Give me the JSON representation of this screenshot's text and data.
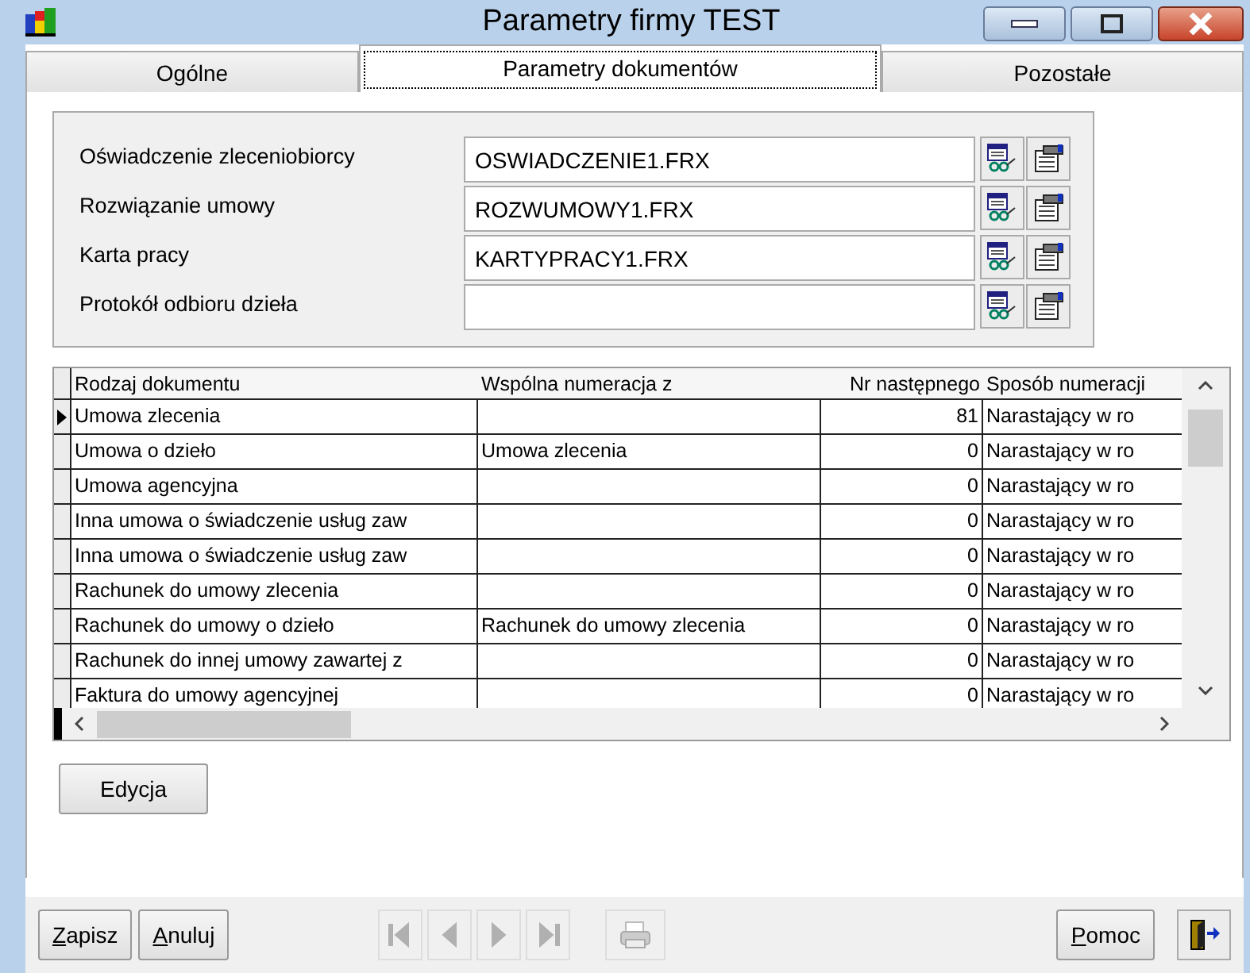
{
  "window": {
    "title": "Parametry firmy TEST"
  },
  "tabs": [
    {
      "label": "Ogólne",
      "selected": false
    },
    {
      "label": "Parametry dokumentów",
      "selected": true
    },
    {
      "label": "Pozostałe",
      "selected": false
    }
  ],
  "report_fields": [
    {
      "label": "Oświadczenie zleceniobiorcy",
      "value": "OSWIADCZENIE1.FRX"
    },
    {
      "label": "Rozwiązanie umowy",
      "value": "ROZWUMOWY1.FRX"
    },
    {
      "label": "Karta pracy",
      "value": "KARTYPRACY1.FRX"
    },
    {
      "label": "Protokół odbioru dzieła"
    }
  ],
  "table": {
    "columns": [
      "Rodzaj dokumentu",
      "Wspólna numeracja z",
      "Nr następnego",
      "Sposób numeracji"
    ],
    "rows": [
      {
        "selected": true,
        "cells": [
          "Umowa zlecenia",
          "",
          "81",
          "Narastający w ro"
        ]
      },
      {
        "selected": false,
        "cells": [
          "Umowa o dzieło",
          "Umowa zlecenia",
          "0",
          "Narastający w ro"
        ]
      },
      {
        "selected": false,
        "cells": [
          "Umowa agencyjna",
          "",
          "0",
          "Narastający w ro"
        ]
      },
      {
        "selected": false,
        "cells": [
          "Inna umowa o świadczenie usług zaw",
          "",
          "0",
          "Narastający w ro"
        ]
      },
      {
        "selected": false,
        "cells": [
          "Inna umowa o świadczenie usług zaw",
          "",
          "0",
          "Narastający w ro"
        ]
      },
      {
        "selected": false,
        "cells": [
          "Rachunek do umowy zlecenia",
          "",
          "0",
          "Narastający w ro"
        ]
      },
      {
        "selected": false,
        "cells": [
          "Rachunek do umowy o dzieło",
          "Rachunek do umowy zlecenia",
          "0",
          "Narastający w ro"
        ]
      },
      {
        "selected": false,
        "cells": [
          "Rachunek do innej umowy zawartej z",
          "",
          "0",
          "Narastający w ro"
        ]
      },
      {
        "selected": false,
        "cells": [
          "Faktura do umowy agencyjnej",
          "",
          "0",
          "Narastający w ro"
        ]
      }
    ]
  },
  "edit_button": "Edycja",
  "footer": {
    "save": "Zapisz",
    "cancel": "Anuluj",
    "help": "Pomoc",
    "nav": [
      {
        "kind": "first",
        "disabled": true
      },
      {
        "kind": "prev",
        "disabled": true
      },
      {
        "kind": "next",
        "disabled": true
      },
      {
        "kind": "last",
        "disabled": true
      }
    ],
    "print_disabled": true
  }
}
